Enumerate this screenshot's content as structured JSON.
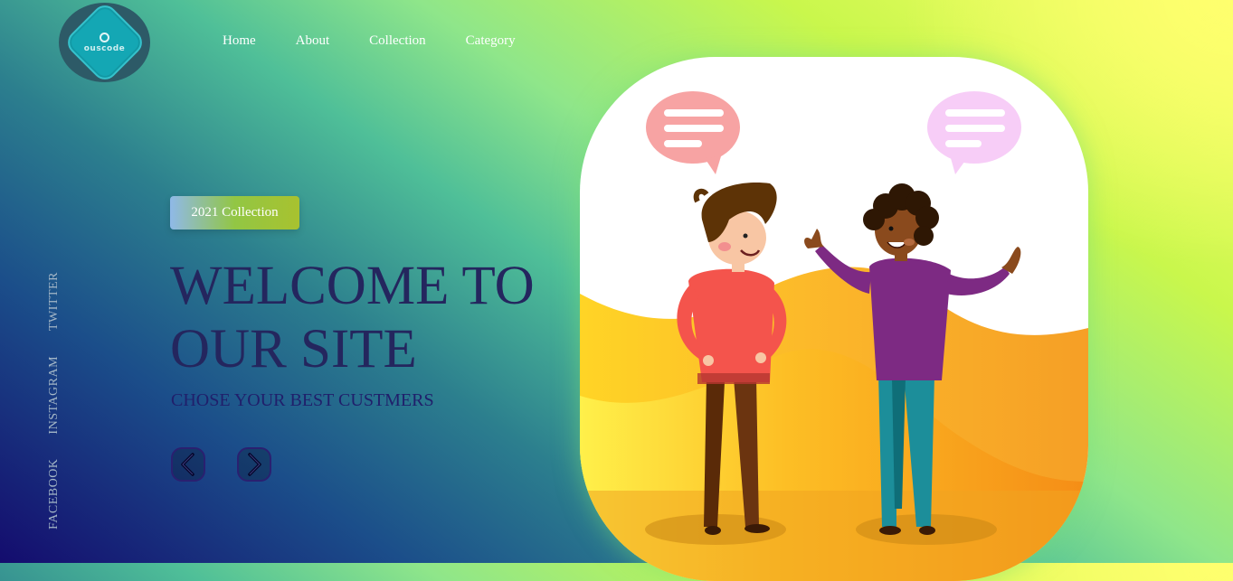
{
  "brand": {
    "logo_text": "ouscode"
  },
  "nav": [
    "Home",
    "About",
    "Collection",
    "Category"
  ],
  "social": [
    "FACEBOOK",
    "INSTAGRAM",
    "TWITTER"
  ],
  "hero": {
    "badge": "2021 Collection",
    "title_line1": "WELCOME TO",
    "title_line2": "OUR SITE",
    "subtitle": "CHOSE YOUR BEST CUSTMERS"
  },
  "controls": {
    "prev_icon": "chevron-left-icon",
    "next_icon": "chevron-right-icon"
  },
  "illustration": {
    "name": "two-people-talking-illustration"
  },
  "colors": {
    "title": "#24265e",
    "badge_start": "#8fb9e8",
    "badge_end": "#a8c22f",
    "nav_text": "#ffffff",
    "social_text": "#a4b7c7"
  }
}
